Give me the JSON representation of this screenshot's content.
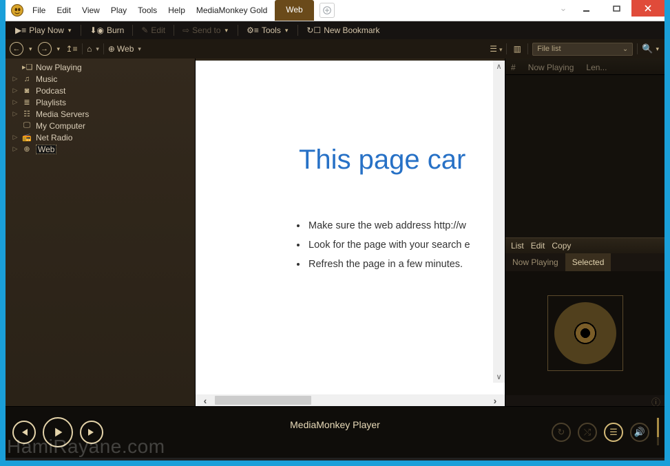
{
  "top_menu": {
    "items": [
      "File",
      "Edit",
      "View",
      "Play",
      "Tools",
      "Help",
      "MediaMonkey Gold"
    ],
    "active_tab": "Web"
  },
  "toolbar1": {
    "play_now": "Play Now",
    "burn": "Burn",
    "edit": "Edit",
    "send_to": "Send to",
    "tools": "Tools",
    "new_bookmark": "New Bookmark"
  },
  "toolbar2": {
    "crumb": "Web",
    "dropdown_label": "File list"
  },
  "sidebar": {
    "items": [
      {
        "label": "Now Playing",
        "expandable": false,
        "icon": "nowplaying"
      },
      {
        "label": "Music",
        "expandable": true,
        "icon": "music"
      },
      {
        "label": "Podcast",
        "expandable": true,
        "icon": "podcast"
      },
      {
        "label": "Playlists",
        "expandable": true,
        "icon": "playlist"
      },
      {
        "label": "Media Servers",
        "expandable": true,
        "icon": "server"
      },
      {
        "label": "My Computer",
        "expandable": false,
        "icon": "computer"
      },
      {
        "label": "Net Radio",
        "expandable": true,
        "icon": "radio"
      },
      {
        "label": "Web",
        "expandable": true,
        "icon": "web",
        "selected": true
      }
    ]
  },
  "browser": {
    "heading": "This page car",
    "bullets": [
      "Make sure the web address http://w",
      "Look for the page with your search e",
      "Refresh the page in a few minutes."
    ]
  },
  "right_pane": {
    "columns": [
      "#",
      "Now Playing",
      "Len..."
    ],
    "mini_menu": [
      "List",
      "Edit",
      "Copy"
    ],
    "tabs": {
      "inactive": "Now Playing",
      "active": "Selected"
    }
  },
  "player": {
    "title": "MediaMonkey Player"
  },
  "watermark": "HamiRayane.com"
}
